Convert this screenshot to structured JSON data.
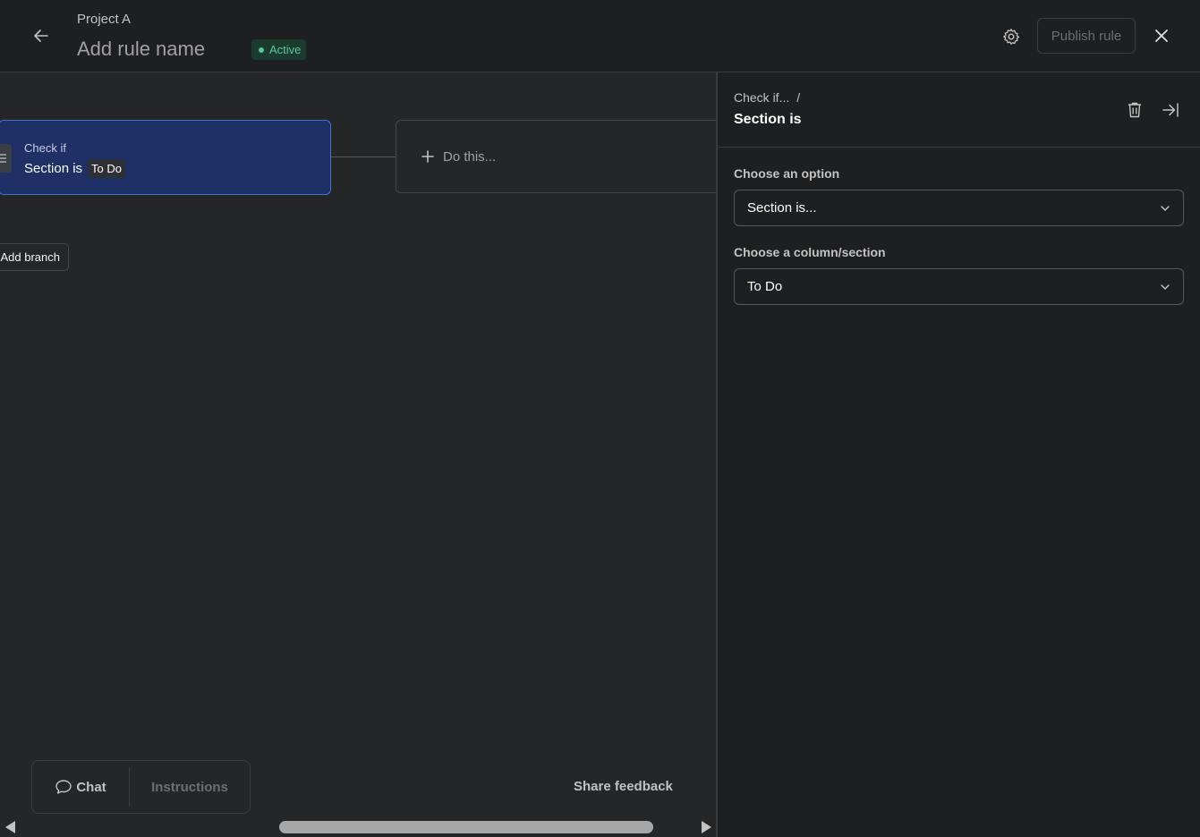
{
  "header": {
    "project": "Project A",
    "rule_name": "Add rule name",
    "status": "Active",
    "publish_label": "Publish rule"
  },
  "canvas": {
    "trigger": {
      "label": "Check if",
      "condition": "Section is",
      "value": "To Do"
    },
    "action_placeholder": "Do this...",
    "add_branch_label": "Add branch",
    "toolbar": {
      "chat_label": "Chat",
      "instructions_label": "Instructions"
    },
    "share_feedback_label": "Share feedback"
  },
  "panel": {
    "breadcrumb": "Check if...",
    "breadcrumb_sep": "/",
    "title": "Section is",
    "option_label": "Choose an option",
    "option_value": "Section is...",
    "column_label": "Choose a column/section",
    "column_value": "To Do"
  },
  "colors": {
    "trigger_bg": "#1e3066",
    "trigger_border": "#4573d2",
    "status_green": "#5ec49a"
  },
  "icons": [
    "back-arrow-icon",
    "gear-icon",
    "close-icon",
    "list-icon",
    "plus-icon",
    "chat-bubble-icon",
    "trash-icon",
    "collapse-right-icon",
    "chevron-down-icon"
  ]
}
